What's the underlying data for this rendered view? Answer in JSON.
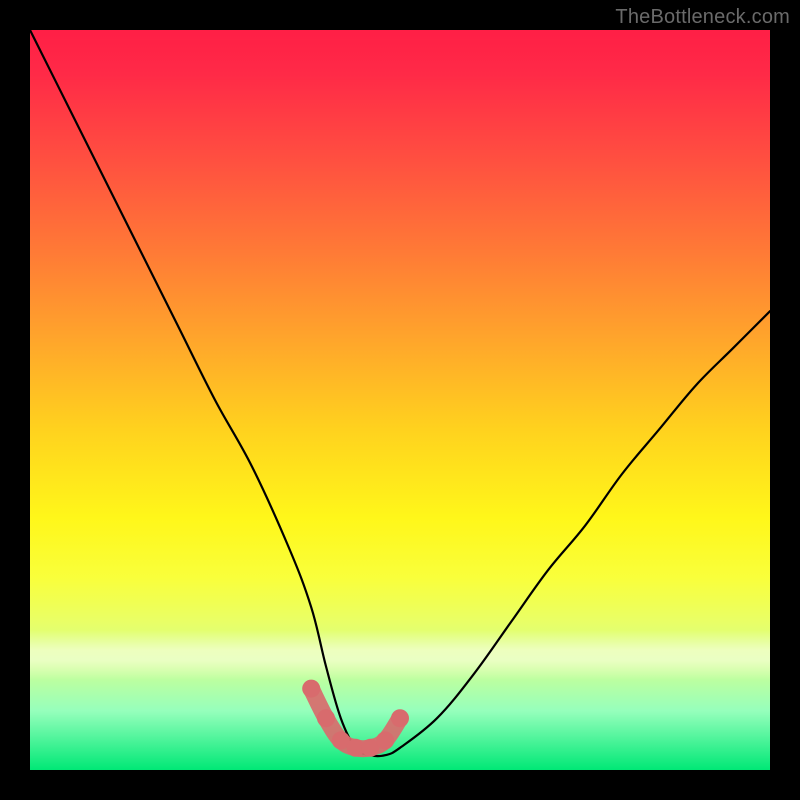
{
  "watermark": "TheBottleneck.com",
  "chart_data": {
    "type": "line",
    "title": "",
    "xlabel": "",
    "ylabel": "",
    "xlim": [
      0,
      100
    ],
    "ylim": [
      0,
      100
    ],
    "series": [
      {
        "name": "bottleneck-curve",
        "x": [
          0,
          5,
          10,
          15,
          20,
          25,
          30,
          35,
          38,
          40,
          42,
          44,
          46,
          48,
          50,
          55,
          60,
          65,
          70,
          75,
          80,
          85,
          90,
          95,
          100
        ],
        "y": [
          100,
          90,
          80,
          70,
          60,
          50,
          41,
          30,
          22,
          14,
          7,
          3,
          2,
          2,
          3,
          7,
          13,
          20,
          27,
          33,
          40,
          46,
          52,
          57,
          62
        ]
      }
    ],
    "highlight": {
      "name": "optimal-range",
      "x": [
        38,
        40,
        42,
        44,
        46,
        48,
        50
      ],
      "y": [
        11,
        7,
        4,
        3,
        3,
        4,
        7
      ]
    },
    "gradient_colors": {
      "top": "#ff1f46",
      "mid": "#ffe11a",
      "bottom": "#00e876"
    }
  }
}
